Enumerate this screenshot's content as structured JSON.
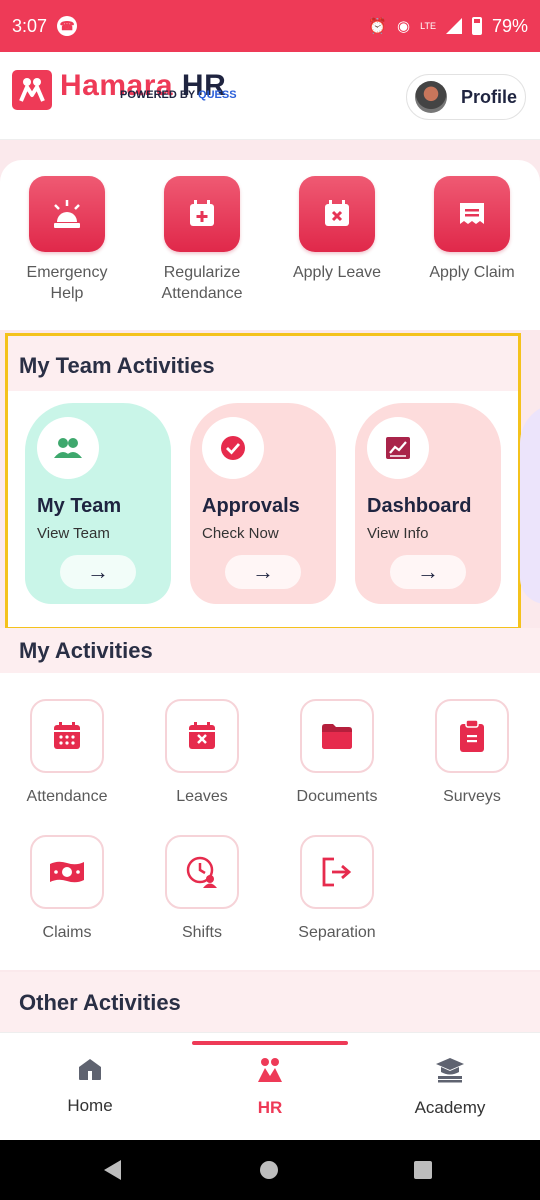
{
  "status_bar": {
    "time": "3:07",
    "network": "LTE",
    "battery": "79%"
  },
  "header": {
    "brand_main": "Hamara",
    "brand_hr": "HR",
    "powered_by": "POWERED BY ",
    "powered_brand": "QUESS",
    "profile_label": "Profile"
  },
  "quick_actions": [
    {
      "label_line1": "Emergency",
      "label_line2": "Help",
      "icon": "siren-icon"
    },
    {
      "label_line1": "Regularize",
      "label_line2": "Attendance",
      "icon": "calendar-plus-icon"
    },
    {
      "label_line1": "Apply Leave",
      "label_line2": "",
      "icon": "calendar-x-icon"
    },
    {
      "label_line1": "Apply Claim",
      "label_line2": "",
      "icon": "receipt-icon"
    }
  ],
  "team_activities": {
    "title": "My Team Activities",
    "cards": [
      {
        "title": "My Team",
        "subtitle": "View Team",
        "icon": "users-icon",
        "color": "#c9f5e8"
      },
      {
        "title": "Approvals",
        "subtitle": "Check Now",
        "icon": "check-circle-icon",
        "color": "#fddcdc"
      },
      {
        "title": "Dashboard",
        "subtitle": "View Info",
        "icon": "chart-icon",
        "color": "#fddcdc"
      }
    ],
    "arrow": "→"
  },
  "my_activities": {
    "title": "My Activities",
    "items": [
      {
        "label": "Attendance",
        "icon": "calendar-icon"
      },
      {
        "label": "Leaves",
        "icon": "calendar-x-icon"
      },
      {
        "label": "Documents",
        "icon": "folder-icon"
      },
      {
        "label": "Surveys",
        "icon": "clipboard-icon"
      },
      {
        "label": "Claims",
        "icon": "cash-icon"
      },
      {
        "label": "Shifts",
        "icon": "clock-person-icon"
      },
      {
        "label": "Separation",
        "icon": "exit-icon"
      }
    ]
  },
  "other_activities": {
    "title": "Other Activities"
  },
  "bottom_nav": {
    "items": [
      {
        "label": "Home",
        "icon": "home-icon"
      },
      {
        "label": "HR",
        "icon": "hr-logo-icon",
        "active": true
      },
      {
        "label": "Academy",
        "icon": "graduation-cap-icon"
      }
    ]
  },
  "colors": {
    "brand": "#ee3a57",
    "navy": "#1f2440",
    "quess_blue": "#2b5fd9",
    "highlight": "#f4c21c"
  }
}
